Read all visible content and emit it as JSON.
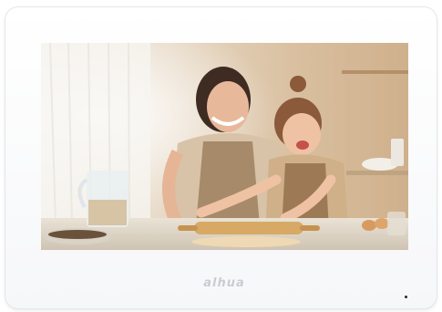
{
  "device": {
    "logo": "alhua",
    "logo_icon": "dahua-brand-logo",
    "screen_content": "family-baking-photo"
  },
  "colors": {
    "bezel": "#ffffff",
    "logo": "#c8ccd2",
    "sensor": "#2a2a2a"
  }
}
